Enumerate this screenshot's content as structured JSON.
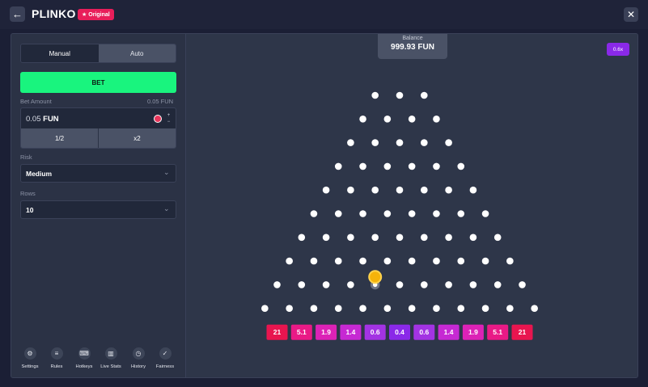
{
  "header": {
    "title": "PLINKO",
    "badge": "Original"
  },
  "controls": {
    "mode_tabs": [
      {
        "label": "Manual",
        "active": true
      },
      {
        "label": "Auto",
        "active": false
      }
    ],
    "bet_label": "BET",
    "bet_amount": {
      "label": "Bet Amount",
      "secondary": "0.05 FUN",
      "value": "0.05",
      "currency": "FUN",
      "half_label": "1/2",
      "double_label": "x2"
    },
    "risk": {
      "label": "Risk",
      "value": "Medium"
    },
    "rows": {
      "label": "Rows",
      "value": "10"
    }
  },
  "footer": [
    {
      "label": "Settings",
      "icon": "gear-icon",
      "glyph": "⚙"
    },
    {
      "label": "Rules",
      "icon": "document-icon",
      "glyph": "≡"
    },
    {
      "label": "Hotkeys",
      "icon": "keyboard-icon",
      "glyph": "⌨"
    },
    {
      "label": "Live Stats",
      "icon": "chart-icon",
      "glyph": "▥"
    },
    {
      "label": "History",
      "icon": "clock-icon",
      "glyph": "◷"
    },
    {
      "label": "Fairness",
      "icon": "check-icon",
      "glyph": "✓"
    }
  ],
  "balance": {
    "label": "Balance",
    "value": "999.93 FUN"
  },
  "last_multiplier": "0.6x",
  "board": {
    "rows": 10,
    "ball": {
      "row": 8,
      "between_pins": [
        3,
        4
      ]
    },
    "highlighted_pin": {
      "row": 8,
      "index": 4
    },
    "multipliers": [
      "21",
      "5.1",
      "1.9",
      "1.4",
      "0.6",
      "0.4",
      "0.6",
      "1.4",
      "1.9",
      "5.1",
      "21"
    ],
    "multiplier_colors": [
      "#e8154f",
      "#e91a86",
      "#dc22b6",
      "#c629d3",
      "#a333e3",
      "#8a29e8",
      "#a333e3",
      "#c629d3",
      "#dc22b6",
      "#e91a86",
      "#e8154f"
    ],
    "pin_color": "#ffffff",
    "ball_color": "#f5b30a"
  },
  "colors": {
    "accent_green": "#19f47e",
    "panel": "#2b3245",
    "board_bg": "#2e3649"
  }
}
